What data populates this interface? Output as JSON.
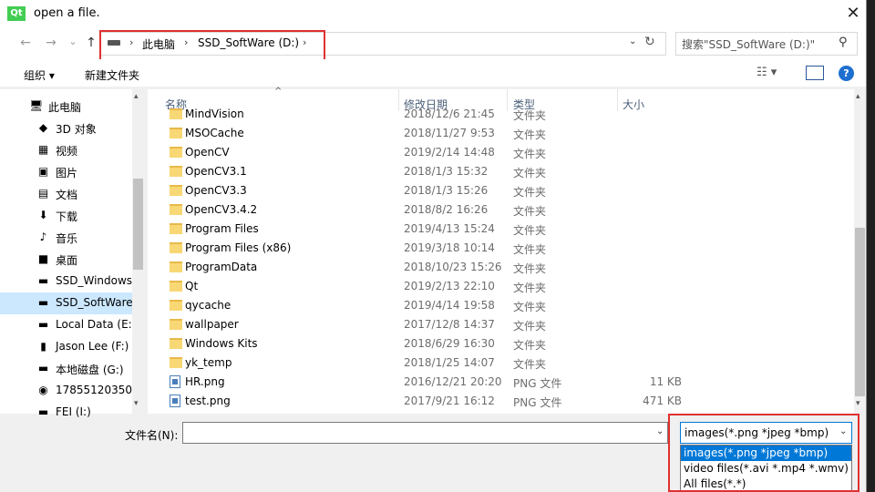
{
  "window": {
    "title": "open a file.",
    "close_glyph": "✕"
  },
  "nav": {
    "back": "←",
    "forward": "→",
    "up": "↑",
    "dropdown": "⌄",
    "breadcrumb": [
      "此电脑",
      "SSD_SoftWare (D:)"
    ],
    "search_placeholder": "搜索\"SSD_SoftWare (D:)\""
  },
  "toolbar": {
    "organize": "组织 ▾",
    "new_folder": "新建文件夹",
    "view": "☷ ▾",
    "help": "?"
  },
  "sidebar": {
    "items": [
      {
        "label": "此电脑",
        "icon": "🖥"
      },
      {
        "label": "3D 对象",
        "icon": "◆"
      },
      {
        "label": "视频",
        "icon": "▦"
      },
      {
        "label": "图片",
        "icon": "▣"
      },
      {
        "label": "文档",
        "icon": "▤"
      },
      {
        "label": "下载",
        "icon": "⬇"
      },
      {
        "label": "音乐",
        "icon": "♪"
      },
      {
        "label": "桌面",
        "icon": "■"
      },
      {
        "label": "SSD_Windows",
        "icon": "▬"
      },
      {
        "label": "SSD_SoftWare",
        "icon": "▬"
      },
      {
        "label": "Local Data (E:)",
        "icon": "▬"
      },
      {
        "label": "Jason Lee (F:)",
        "icon": "▮"
      },
      {
        "label": "本地磁盘 (G:)",
        "icon": "▬"
      },
      {
        "label": "17855120350",
        "icon": "◉"
      },
      {
        "label": "FEI (I:)",
        "icon": "▬"
      }
    ]
  },
  "columns": {
    "name": "名称",
    "date": "修改日期",
    "type": "类型",
    "size": "大小"
  },
  "files": [
    {
      "name": "MindVision",
      "date": "2018/12/6 21:45",
      "type": "文件夹",
      "size": "",
      "kind": "folder"
    },
    {
      "name": "MSOCache",
      "date": "2018/11/27 9:53",
      "type": "文件夹",
      "size": "",
      "kind": "folder"
    },
    {
      "name": "OpenCV",
      "date": "2019/2/14 14:48",
      "type": "文件夹",
      "size": "",
      "kind": "folder"
    },
    {
      "name": "OpenCV3.1",
      "date": "2018/1/3 15:32",
      "type": "文件夹",
      "size": "",
      "kind": "folder"
    },
    {
      "name": "OpenCV3.3",
      "date": "2018/1/3 15:26",
      "type": "文件夹",
      "size": "",
      "kind": "folder"
    },
    {
      "name": "OpenCV3.4.2",
      "date": "2018/8/2 16:26",
      "type": "文件夹",
      "size": "",
      "kind": "folder"
    },
    {
      "name": "Program Files",
      "date": "2019/4/13 15:24",
      "type": "文件夹",
      "size": "",
      "kind": "folder"
    },
    {
      "name": "Program Files (x86)",
      "date": "2019/3/18 10:14",
      "type": "文件夹",
      "size": "",
      "kind": "folder"
    },
    {
      "name": "ProgramData",
      "date": "2018/10/23 15:26",
      "type": "文件夹",
      "size": "",
      "kind": "folder"
    },
    {
      "name": "Qt",
      "date": "2019/2/13 22:10",
      "type": "文件夹",
      "size": "",
      "kind": "folder"
    },
    {
      "name": "qycache",
      "date": "2019/4/14 19:58",
      "type": "文件夹",
      "size": "",
      "kind": "folder"
    },
    {
      "name": "wallpaper",
      "date": "2017/12/8 14:37",
      "type": "文件夹",
      "size": "",
      "kind": "folder"
    },
    {
      "name": "Windows Kits",
      "date": "2018/6/29 16:30",
      "type": "文件夹",
      "size": "",
      "kind": "folder"
    },
    {
      "name": "yk_temp",
      "date": "2018/1/25 14:07",
      "type": "文件夹",
      "size": "",
      "kind": "folder"
    },
    {
      "name": "HR.png",
      "date": "2016/12/21 20:20",
      "type": "PNG 文件",
      "size": "11 KB",
      "kind": "file"
    },
    {
      "name": "test.png",
      "date": "2017/9/21 16:12",
      "type": "PNG 文件",
      "size": "471 KB",
      "kind": "file"
    }
  ],
  "bottom": {
    "filename_label": "文件名(N):",
    "filename_value": "",
    "filter_selected": "images(*.png *jpeg *bmp)",
    "filter_options": [
      "images(*.png *jpeg *bmp)",
      "video files(*.avi *.mp4 *.wmv)",
      "All files(*.*)"
    ]
  },
  "colors": {
    "accent": "#0078d7",
    "highlight": "#e03030",
    "selection": "#cce8ff"
  }
}
